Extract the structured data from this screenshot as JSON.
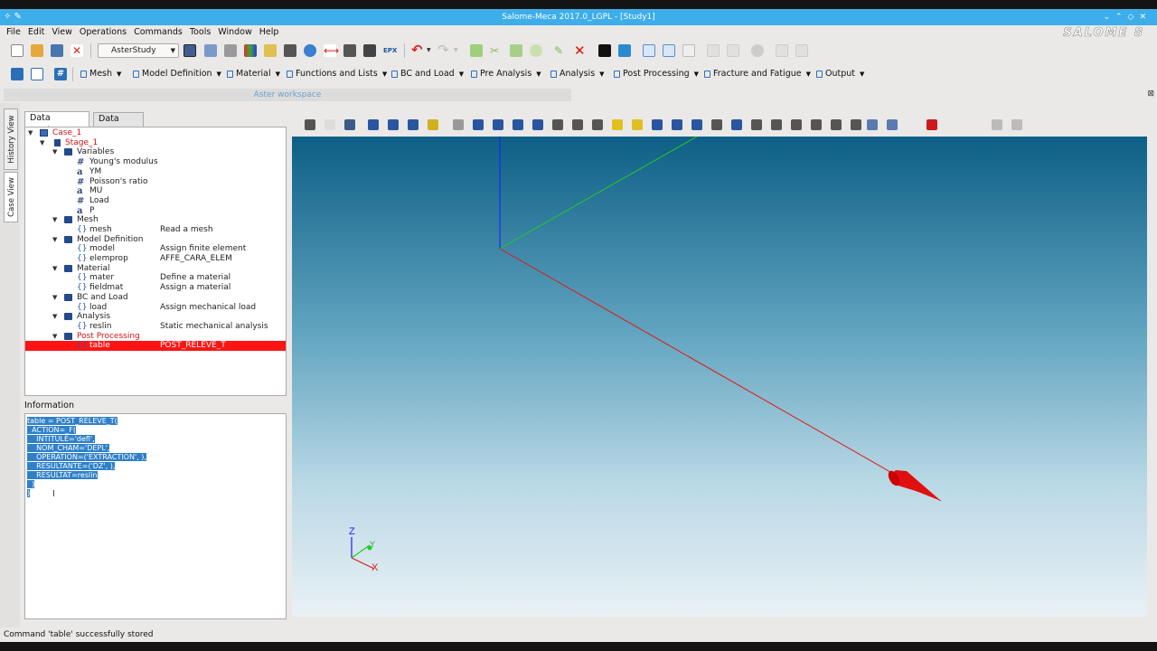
{
  "window": {
    "title": "Salome-Meca 2017.0_LGPL - [Study1]",
    "logo_text": "SALOME 8"
  },
  "menubar": {
    "items": [
      "File",
      "Edit",
      "View",
      "Operations",
      "Commands",
      "Tools",
      "Window",
      "Help"
    ]
  },
  "toolbar": {
    "module_combo": "AsterStudy"
  },
  "module_toolbar": {
    "menus": [
      "Mesh",
      "Model Definition",
      "Material",
      "Functions and Lists",
      "BC and Load",
      "Pre Analysis",
      "Analysis",
      "Post Processing",
      "Fracture and Fatigue",
      "Output"
    ]
  },
  "workspace": {
    "title": "Aster workspace"
  },
  "side_tabs": {
    "history": "History View",
    "case": "Case View"
  },
  "tabs": {
    "data_settings": "Data Settings",
    "data_files": "Data Files"
  },
  "tree": {
    "case": "Case_1",
    "stage": "Stage_1",
    "variables_label": "Variables",
    "variables": [
      "Young's modulus",
      "YM",
      "Poisson's ratio",
      "MU",
      "Load",
      "P"
    ],
    "groups": [
      {
        "name": "Mesh",
        "items": [
          {
            "name": "mesh",
            "desc": "Read a mesh"
          }
        ]
      },
      {
        "name": "Model Definition",
        "items": [
          {
            "name": "model",
            "desc": "Assign finite element"
          },
          {
            "name": "elemprop",
            "desc": "AFFE_CARA_ELEM"
          }
        ]
      },
      {
        "name": "Material",
        "items": [
          {
            "name": "mater",
            "desc": "Define a material"
          },
          {
            "name": "fieldmat",
            "desc": "Assign a material"
          }
        ]
      },
      {
        "name": "BC and Load",
        "items": [
          {
            "name": "load",
            "desc": "Assign mechanical load"
          }
        ]
      },
      {
        "name": "Analysis",
        "items": [
          {
            "name": "reslin",
            "desc": "Static mechanical analysis"
          }
        ]
      },
      {
        "name": "Post Processing",
        "items": [
          {
            "name": "table",
            "desc": "POST_RELEVE_T"
          }
        ]
      }
    ]
  },
  "information": {
    "label": "Information",
    "lines": [
      "table = POST_RELEVE_T(",
      "  ACTION=_F(",
      "    INTITULE='defl',",
      "    NOM_CHAM='DEPL',",
      "    OPERATION=('EXTRACTION', ),",
      "    RESULTANTE=('DZ', ),",
      "    RESULTAT=reslin",
      "  )",
      ")"
    ]
  },
  "axes": {
    "x": "X",
    "y": "Y",
    "z": "Z"
  },
  "status": {
    "message": "Command 'table' successfully stored"
  }
}
